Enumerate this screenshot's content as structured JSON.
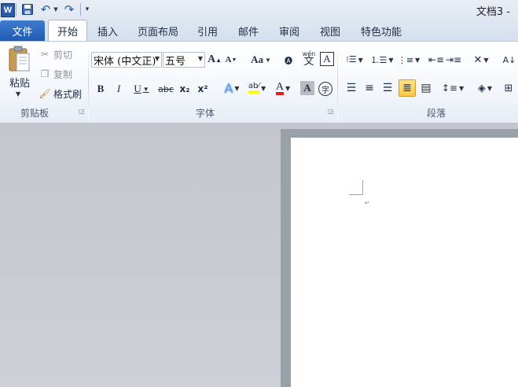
{
  "app": {
    "doc_title": "文档3 -",
    "logo_letter": "W"
  },
  "tabs": {
    "file": "文件",
    "home": "开始",
    "insert": "插入",
    "layout": "页面布局",
    "references": "引用",
    "mailings": "邮件",
    "review": "审阅",
    "view": "视图",
    "addins": "特色功能"
  },
  "clipboard": {
    "paste": "粘贴",
    "cut": "剪切",
    "copy": "复制",
    "format_painter": "格式刷",
    "group_label": "剪贴板"
  },
  "font": {
    "font_name": "宋体 (中文正)",
    "font_size": "五号",
    "grow": "A",
    "shrink": "A",
    "change_case": "Aa",
    "bold": "B",
    "italic": "I",
    "underline": "U",
    "strikethrough": "abc",
    "subscript": "x₂",
    "superscript": "x²",
    "char_border": "A",
    "char_shading": "A",
    "enclose": "字",
    "phonetic_top": "wén",
    "phonetic_char": "文",
    "group_label": "字体"
  },
  "paragraph": {
    "group_label": "段落"
  },
  "colors": {
    "file_tab": "#2b6bc4",
    "font_color": "#e02020",
    "highlight": "#ffff00"
  }
}
